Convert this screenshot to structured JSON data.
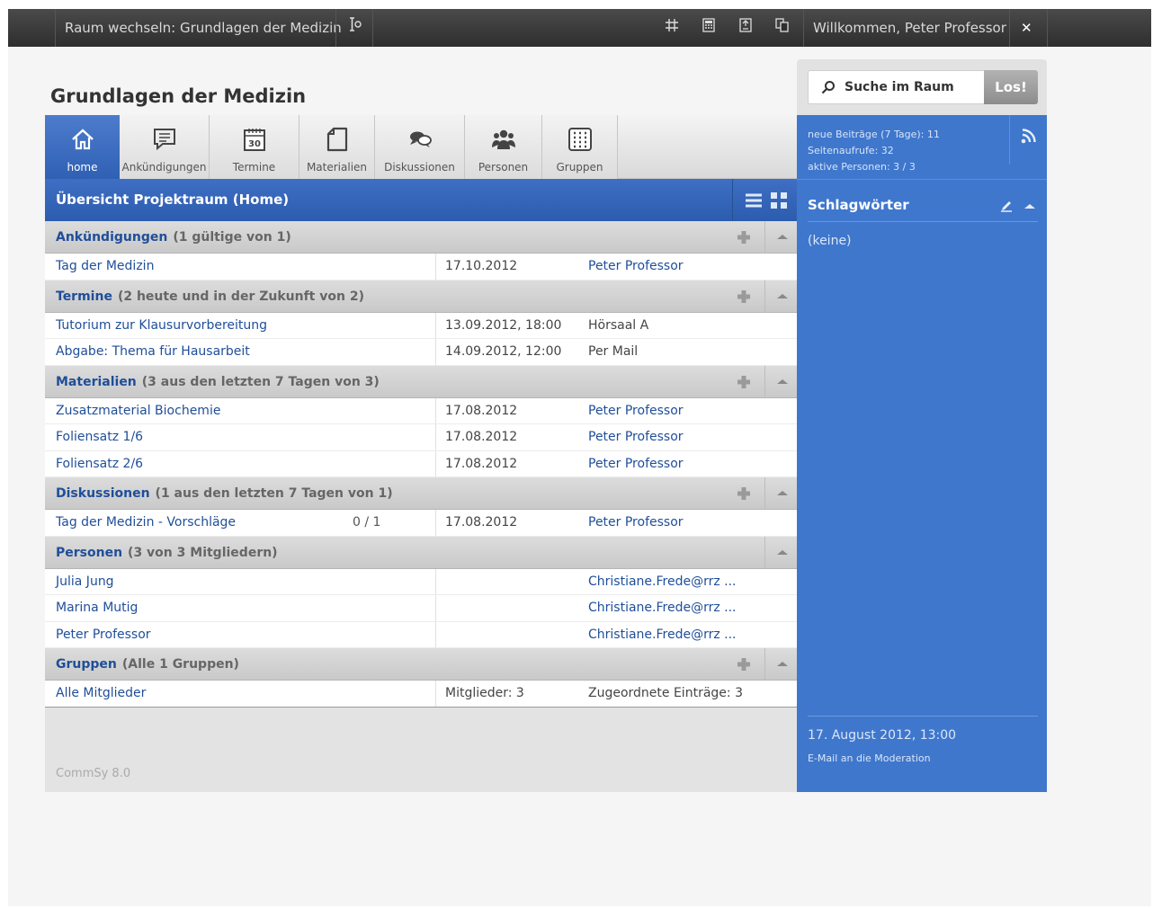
{
  "topbar": {
    "room_switch": "Raum wechseln: Grundlagen der Medizin",
    "welcome": "Willkommen, Peter Professor",
    "close": "✕"
  },
  "page": {
    "title": "Grundlagen der Medizin",
    "overview_title": "Übersicht Projektraum (Home)",
    "footer": "CommSy 8.0"
  },
  "tabs": [
    {
      "label": "home",
      "icon": "home-icon"
    },
    {
      "label": "Ankündigungen",
      "icon": "announcement-icon"
    },
    {
      "label": "Termine",
      "icon": "calendar-icon"
    },
    {
      "label": "Materialien",
      "icon": "document-icon"
    },
    {
      "label": "Diskussionen",
      "icon": "discussion-icon"
    },
    {
      "label": "Personen",
      "icon": "people-icon"
    },
    {
      "label": "Gruppen",
      "icon": "groups-icon"
    }
  ],
  "sections": {
    "ankuendigungen": {
      "name": "Ankündigungen",
      "count": "(1 gültige von 1)",
      "rows": [
        {
          "title": "Tag der Medizin",
          "date": "17.10.2012",
          "meta": "Peter Professor"
        }
      ]
    },
    "termine": {
      "name": "Termine",
      "count": "(2 heute und in der Zukunft von 2)",
      "rows": [
        {
          "title": "Tutorium zur Klausurvorbereitung",
          "date": "13.09.2012, 18:00",
          "meta": "Hörsaal A"
        },
        {
          "title": "Abgabe: Thema für Hausarbeit",
          "date": "14.09.2012, 12:00",
          "meta": "Per Mail"
        }
      ]
    },
    "materialien": {
      "name": "Materialien",
      "count": "(3 aus den letzten 7 Tagen von 3)",
      "rows": [
        {
          "title": "Zusatzmaterial Biochemie",
          "date": "17.08.2012",
          "meta": "Peter Professor"
        },
        {
          "title": "Foliensatz 1/6",
          "date": "17.08.2012",
          "meta": "Peter Professor"
        },
        {
          "title": "Foliensatz 2/6",
          "date": "17.08.2012",
          "meta": "Peter Professor"
        }
      ]
    },
    "diskussionen": {
      "name": "Diskussionen",
      "count": "(1 aus den letzten 7 Tagen von 1)",
      "rows": [
        {
          "title": "Tag der Medizin - Vorschläge",
          "articles": "0 / 1",
          "date": "17.08.2012",
          "meta": "Peter Professor"
        }
      ]
    },
    "personen": {
      "name": "Personen",
      "count": "(3 von 3 Mitgliedern)",
      "rows": [
        {
          "title": "Julia Jung",
          "meta": "Christiane.Frede@rrz ..."
        },
        {
          "title": "Marina Mutig",
          "meta": "Christiane.Frede@rrz ..."
        },
        {
          "title": "Peter Professor",
          "meta": "Christiane.Frede@rrz ..."
        }
      ]
    },
    "gruppen": {
      "name": "Gruppen",
      "count": "(Alle 1 Gruppen)",
      "rows": [
        {
          "title": "Alle Mitglieder",
          "date": "Mitglieder: 3",
          "meta": "Zugeordnete Einträge: 3"
        }
      ]
    }
  },
  "search": {
    "placeholder": "Suche im Raum",
    "button": "Los!"
  },
  "sidebar": {
    "stat_posts": "neue Beiträge (7 Tage): 11",
    "stat_views": "Seitenaufrufe: 32",
    "stat_active": "aktive Personen: 3 / 3",
    "keywords_title": "Schlagwörter",
    "keywords_none": "(keine)",
    "date": "17. August 2012, 13:00",
    "mail_link": "E-Mail an die Moderation"
  },
  "colors": {
    "accent_blue": "#3f77cd",
    "link_blue": "#1f4e99",
    "topbar_dark": "#3a3a3a"
  }
}
